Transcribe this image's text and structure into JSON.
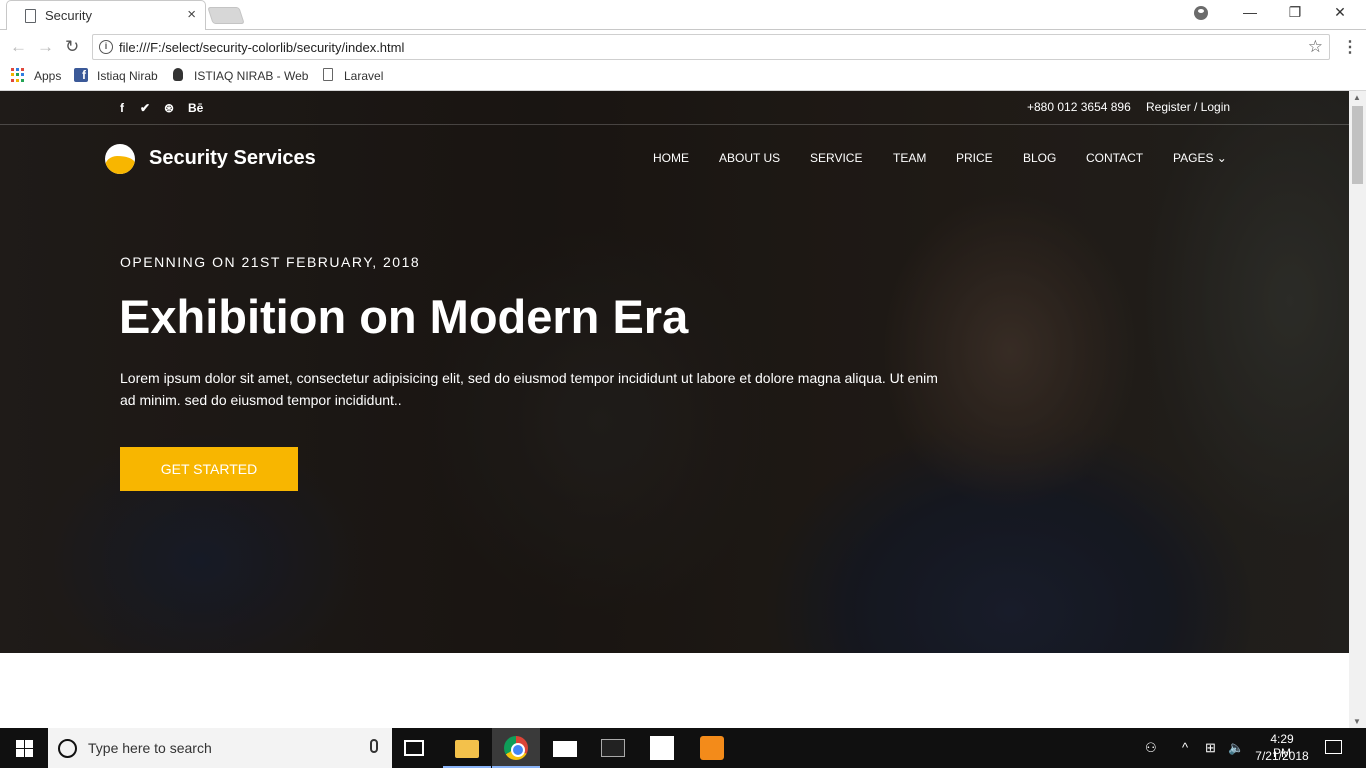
{
  "browser": {
    "tab_title": "Security",
    "tab_close": "×",
    "url": "file:///F:/select/security-colorlib/security/index.html",
    "window_controls": {
      "minimize": "—",
      "maximize": "❐",
      "close": "✕"
    },
    "nav": {
      "back": "←",
      "forward": "→",
      "reload": "↻",
      "star": "☆",
      "menu": "⋮",
      "info": "i"
    },
    "bookmarks": [
      {
        "label": "Apps",
        "icon": "apps-grid-icon"
      },
      {
        "label": "Istiaq Nirab",
        "icon": "facebook-icon"
      },
      {
        "label": "ISTIAQ NIRAB - Web",
        "icon": "mask-icon"
      },
      {
        "label": "Laravel",
        "icon": "page-icon"
      }
    ],
    "fb_glyph": "f"
  },
  "topbar": {
    "social": [
      {
        "glyph": "f",
        "icon": "facebook-icon"
      },
      {
        "glyph": "✔",
        "icon": "twitter-icon"
      },
      {
        "glyph": "⊛",
        "icon": "dribbble-icon"
      },
      {
        "glyph": "Bē",
        "icon": "behance-icon"
      }
    ],
    "phone": "+880 012 3654 896",
    "register": "Register / Login"
  },
  "header": {
    "brand": "Security Services",
    "nav": [
      "HOME",
      "ABOUT US",
      "SERVICE",
      "TEAM",
      "PRICE",
      "BLOG",
      "CONTACT",
      "PAGES ⌄"
    ]
  },
  "hero": {
    "eyebrow": "OPENNING ON 21ST FEBRUARY, 2018",
    "headline": "Exhibition on Modern Era",
    "paragraph": "Lorem ipsum dolor sit amet, consectetur adipisicing elit, sed do eiusmod tempor incididunt ut labore et dolore magna aliqua. Ut enim ad minim. sed do eiusmod tempor incididunt..",
    "cta": "GET STARTED"
  },
  "colors": {
    "accent": "#f8b600",
    "taskbar": "#101010"
  },
  "taskbar": {
    "search_placeholder": "Type here to search",
    "time": "4:29 PM",
    "date": "7/21/2018",
    "tray": {
      "people": "⚇",
      "chevron": "^",
      "network": "⊞",
      "volume": "🔈"
    },
    "apps": [
      "task-view-icon",
      "file-explorer-icon",
      "chrome-icon",
      "mail-icon",
      "cmd-icon",
      "snipping-tool-icon",
      "sublime-text-icon"
    ]
  }
}
